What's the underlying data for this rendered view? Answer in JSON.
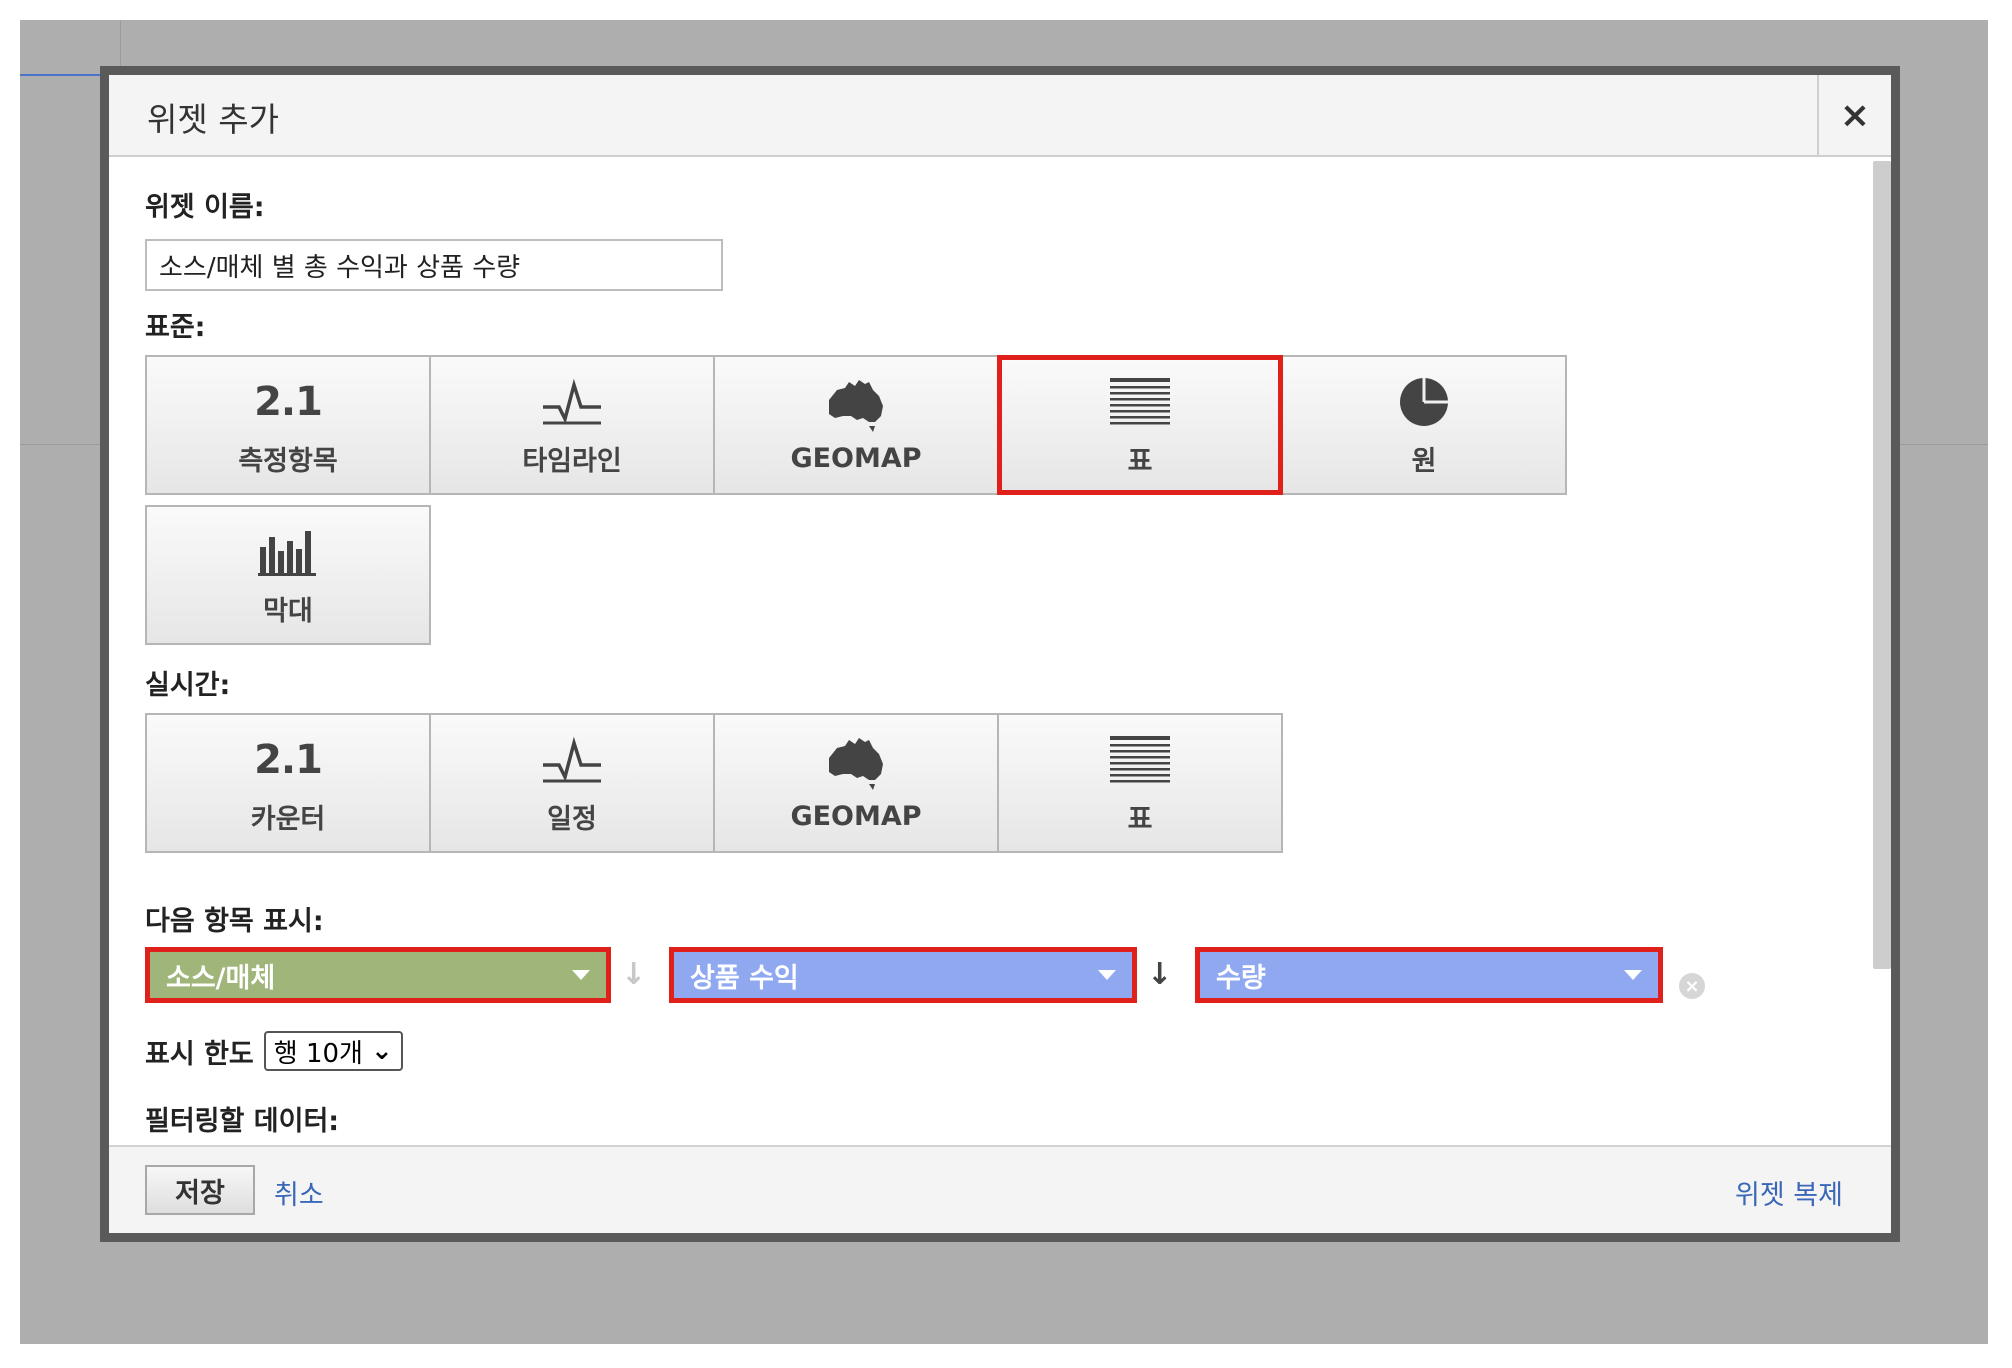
{
  "dialog": {
    "title": "위젯 추가",
    "close_label": "×"
  },
  "widget_name": {
    "label": "위젯 이름:",
    "value": "소스/매체 별 총 수익과 상품 수량"
  },
  "standard": {
    "label": "표준:",
    "tiles": [
      {
        "label": "측정항목",
        "number": "2.1",
        "icon": "metric-icon"
      },
      {
        "label": "타임라인",
        "icon": "timeline-icon"
      },
      {
        "label": "GEOMAP",
        "icon": "australia-map-icon"
      },
      {
        "label": "표",
        "icon": "table-lines-icon",
        "selected": true
      },
      {
        "label": "원",
        "icon": "pie-chart-icon"
      },
      {
        "label": "막대",
        "icon": "bar-chart-icon"
      }
    ]
  },
  "realtime": {
    "label": "실시간:",
    "tiles": [
      {
        "label": "카운터",
        "number": "2.1",
        "icon": "counter-icon"
      },
      {
        "label": "일정",
        "icon": "timeline-icon"
      },
      {
        "label": "GEOMAP",
        "icon": "australia-map-icon"
      },
      {
        "label": "표",
        "icon": "table-lines-icon"
      }
    ]
  },
  "display": {
    "label": "다음 항목 표시:",
    "dimension": "소스/매체",
    "metric1": "상품 수익",
    "metric2": "수량",
    "dimension_color": "#9fb57a",
    "metric_color": "#8fa8f0",
    "highlight_color": "#e0211b"
  },
  "limit": {
    "label": "표시 한도",
    "value": "행 10개"
  },
  "filter": {
    "label": "필터링할 데이터:"
  },
  "footer": {
    "save": "저장",
    "cancel": "취소",
    "copy": "위젯 복제"
  }
}
